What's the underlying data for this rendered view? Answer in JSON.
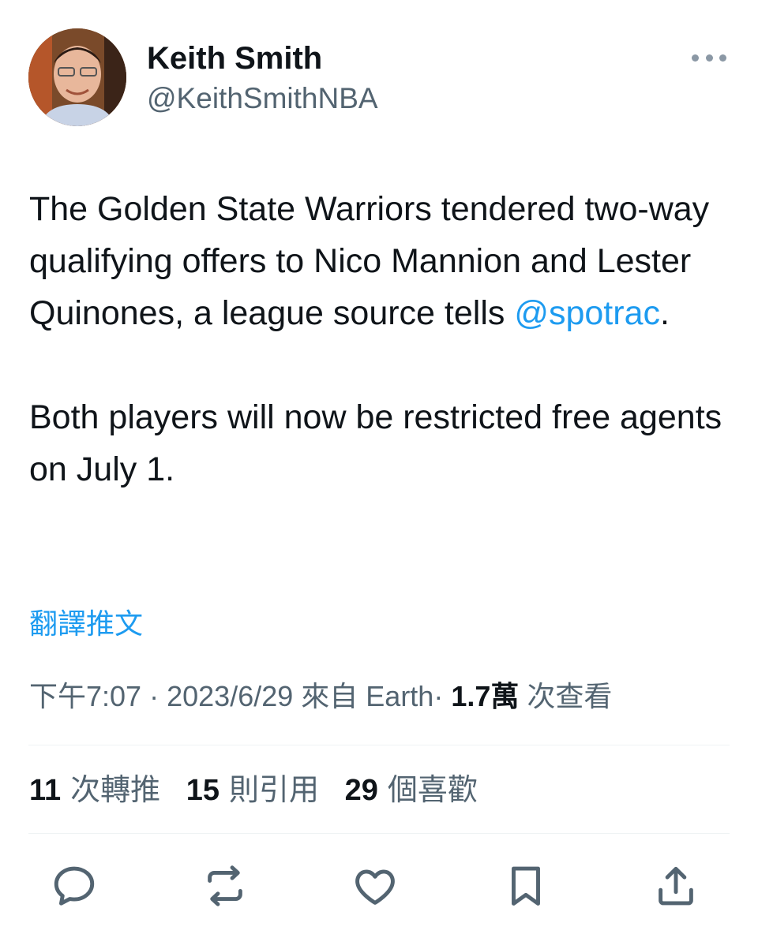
{
  "author": {
    "name": "Keith Smith",
    "handle": "@KeithSmithNBA",
    "avatar_icon": "user-avatar"
  },
  "tweet": {
    "paragraph1_text": "The Golden State Warriors tendered two-way qualifying offers to Nico Mannion and Lester Quinones, a league source tells ",
    "mention": "@spotrac",
    "paragraph1_end": ".",
    "paragraph2": "Both players will now be restricted free agents on July 1."
  },
  "translate_label": "翻譯推文",
  "meta": {
    "time": "下午7:07",
    "date": "2023/6/29",
    "source": "來自 Earth",
    "views_count": "1.7萬",
    "views_label": "次查看",
    "separator": "·"
  },
  "stats": [
    {
      "count": "11",
      "label": "次轉推"
    },
    {
      "count": "15",
      "label": "則引用"
    },
    {
      "count": "29",
      "label": "個喜歡"
    }
  ],
  "actions": [
    "reply-icon",
    "retweet-icon",
    "like-icon",
    "bookmark-icon",
    "share-icon"
  ],
  "colors": {
    "accent": "#1d9bf0",
    "text": "#0f1419",
    "secondary": "#536471",
    "icon": "#536471",
    "divider": "#eff3f4"
  }
}
